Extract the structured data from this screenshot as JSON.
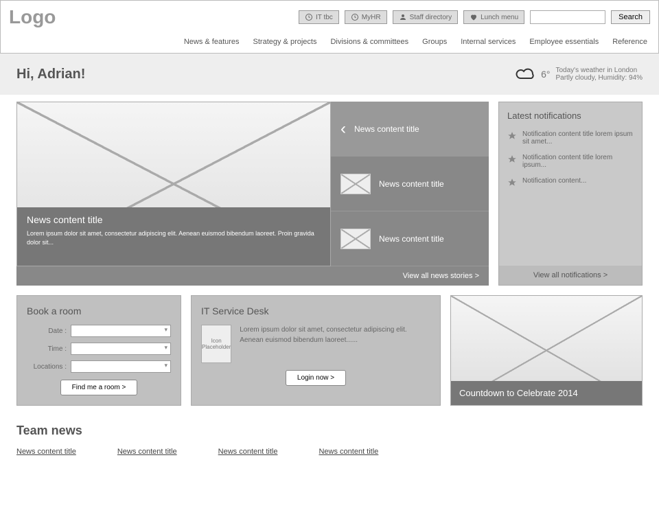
{
  "header": {
    "logo": "Logo",
    "quick_links": [
      {
        "icon": "clock",
        "label": "IT tbc"
      },
      {
        "icon": "clock",
        "label": "MyHR"
      },
      {
        "icon": "person",
        "label": "Staff directory"
      },
      {
        "icon": "heart",
        "label": "Lunch menu"
      }
    ],
    "search_btn": "Search",
    "nav": [
      "News & features",
      "Strategy & projects",
      "Divisions & committees",
      "Groups",
      "Internal services",
      "Employee essentials",
      "Reference"
    ]
  },
  "greeting": "Hi, Adrian!",
  "weather": {
    "temp": "6°",
    "line1": "Today's weather in London",
    "line2": "Partly cloudy,  Humidity: 94%"
  },
  "news": {
    "hero": {
      "title": "News content title",
      "desc": "Lorem ipsum dolor sit amet, consectetur adipiscing elit. Aenean euismod bibendum laoreet. Proin gravida dolor sit..."
    },
    "side": [
      "News content title",
      "News content title",
      "News content title"
    ],
    "footer": "View all news stories >"
  },
  "notifications": {
    "heading": "Latest notifications",
    "items": [
      "Notification content title lorem ipsum sit amet...",
      "Notification content title lorem ipsum...",
      "Notification content..."
    ],
    "footer": "View all notifications >"
  },
  "book_room": {
    "heading": "Book a room",
    "labels": {
      "date": "Date :",
      "time": "Time :",
      "loc": "Locations :"
    },
    "button": "Find me a room >"
  },
  "it_desk": {
    "heading": "IT Service Desk",
    "icon_ph": "Icon Placeholder",
    "text": "Lorem ipsum dolor sit amet, consectetur adipiscing elit. Aenean euismod bibendum laoreet......",
    "button": "Login now >"
  },
  "countdown": "Countdown to Celebrate 2014",
  "team_news": {
    "heading": "Team news",
    "items": [
      "News content title",
      "News content title",
      "News content title",
      "News content title"
    ]
  }
}
